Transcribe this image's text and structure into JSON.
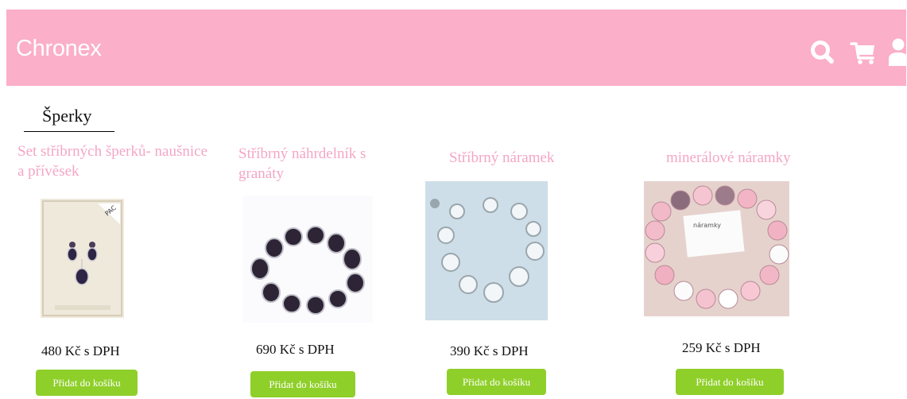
{
  "header": {
    "brand": "Chronex",
    "background": "#fbafc8",
    "icons": [
      "search-icon",
      "cart-icon",
      "user-icon",
      "menu-icon"
    ]
  },
  "category": {
    "title": "Šperky"
  },
  "products": [
    {
      "title": "Set stříbrných šperků- naušnice a přívěsek",
      "price": "480 Kč s DPH",
      "button": "Přidat do košíku"
    },
    {
      "title": "Stříbrný náhrdelník s granáty",
      "price": "690 Kč s DPH",
      "button": "Přidat do košíku"
    },
    {
      "title": "Stříbrný náramek",
      "price": "390 Kč s DPH",
      "button": "Přidat do košíku"
    },
    {
      "title": "minerálové náramky",
      "price": "259 Kč s DPH",
      "button": "Přidat do košíku"
    }
  ],
  "colors": {
    "accent_pink": "#f4a6c5",
    "button_green": "#8fcf2a"
  }
}
